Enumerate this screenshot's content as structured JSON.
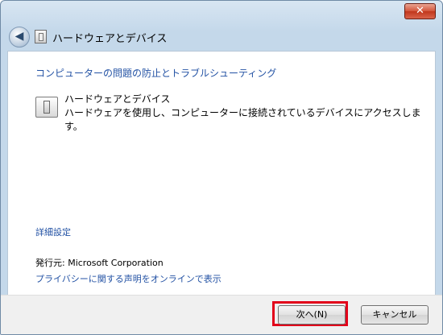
{
  "window": {
    "close_glyph": "✕"
  },
  "header": {
    "back_glyph": "◀",
    "title_icon": "hardware-device-icon",
    "title": "ハードウェアとデバイス"
  },
  "content": {
    "heading": "コンピューターの問題の防止とトラブルシューティング",
    "option": {
      "icon": "hardware-device-icon",
      "title": "ハードウェアとデバイス",
      "description": "ハードウェアを使用し、コンピューターに接続されているデバイスにアクセスします。"
    },
    "advanced_link": "詳細設定",
    "publisher": "発行元:  Microsoft Corporation",
    "privacy_link": "プライバシーに関する声明をオンラインで表示"
  },
  "footer": {
    "next_label": "次へ(N)",
    "cancel_label": "キャンセル",
    "highlight_color": "#e2001a"
  }
}
